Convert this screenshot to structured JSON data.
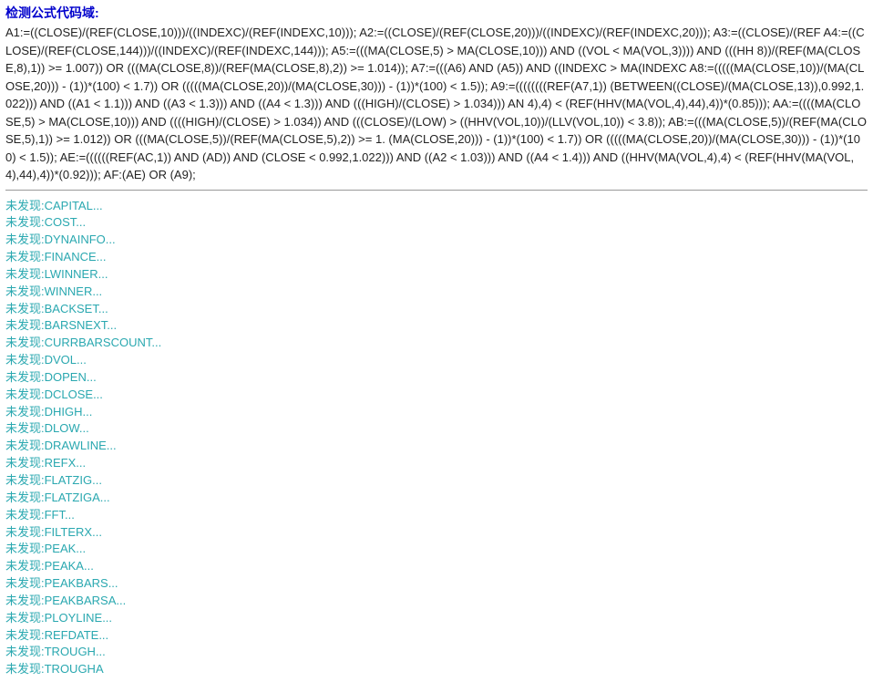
{
  "section_title": "检测公式代码域:",
  "formula_text": "A1:=((CLOSE)/(REF(CLOSE,10)))/((INDEXC)/(REF(INDEXC,10))); A2:=((CLOSE)/(REF(CLOSE,20)))/((INDEXC)/(REF(INDEXC,20))); A3:=((CLOSE)/(REF A4:=((CLOSE)/(REF(CLOSE,144)))/((INDEXC)/(REF(INDEXC,144))); A5:=(((MA(CLOSE,5) > MA(CLOSE,10))) AND ((VOL < MA(VOL,3)))) AND (((HH 8))/(REF(MA(CLOSE,8),1)) >= 1.007)) OR (((MA(CLOSE,8))/(REF(MA(CLOSE,8),2)) >= 1.014)); A7:=(((A6) AND (A5)) AND ((INDEXC > MA(INDEXC A8:=(((((MA(CLOSE,10))/(MA(CLOSE,20))) - (1))*(100) < 1.7)) OR (((((MA(CLOSE,20))/(MA(CLOSE,30))) - (1))*(100) < 1.5)); A9:=((((((((REF(A7,1)) (BETWEEN((CLOSE)/(MA(CLOSE,13)),0.992,1.022))) AND ((A1 < 1.1))) AND ((A3 < 1.3))) AND ((A4 < 1.3))) AND (((HIGH)/(CLOSE) > 1.034))) AN 4),4) < (REF(HHV(MA(VOL,4),44),4))*(0.85))); AA:=((((MA(CLOSE,5) > MA(CLOSE,10))) AND ((((HIGH)/(CLOSE) > 1.034)) AND (((CLOSE)/(LOW) > ((HHV(VOL,10))/(LLV(VOL,10)) < 3.8)); AB:=(((MA(CLOSE,5))/(REF(MA(CLOSE,5),1)) >= 1.012)) OR (((MA(CLOSE,5))/(REF(MA(CLOSE,5),2)) >= 1. (MA(CLOSE,20))) - (1))*(100) < 1.7)) OR (((((MA(CLOSE,20))/(MA(CLOSE,30))) - (1))*(100) < 1.5)); AE:=((((((REF(AC,1)) AND (AD)) AND (CLOSE < 0.992,1.022))) AND ((A2 < 1.03))) AND ((A4 < 1.4))) AND ((HHV(MA(VOL,4),4) < (REF(HHV(MA(VOL,4),44),4))*(0.92))); AF:(AE) OR (A9);",
  "notfound_prefix": "未发现:",
  "notfound_items": [
    "CAPITAL...",
    "COST...",
    "DYNAINFO...",
    "FINANCE...",
    "LWINNER...",
    "WINNER...",
    "BACKSET...",
    "BARSNEXT...",
    "CURRBARSCOUNT...",
    "DVOL...",
    "DOPEN...",
    "DCLOSE...",
    "DHIGH...",
    "DLOW...",
    "DRAWLINE...",
    "REFX...",
    "FLATZIG...",
    "FLATZIGA...",
    "FFT...",
    "FILTERX...",
    "PEAK...",
    "PEAKA...",
    "PEAKBARS...",
    "PEAKBARSA...",
    "PLOYLINE...",
    "REFDATE...",
    "TROUGH...",
    "TROUGHA"
  ]
}
